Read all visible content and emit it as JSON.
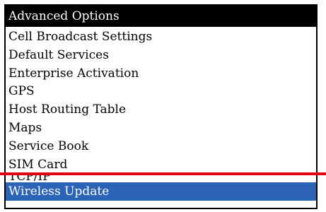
{
  "header": {
    "title": "Advanced Options"
  },
  "menu": {
    "items": [
      {
        "label": "Cell Broadcast Settings"
      },
      {
        "label": "Default Services"
      },
      {
        "label": "Enterprise Activation"
      },
      {
        "label": "GPS"
      },
      {
        "label": "Host Routing Table"
      },
      {
        "label": "Maps"
      },
      {
        "label": "Service Book"
      },
      {
        "label": "SIM Card"
      },
      {
        "label": "TCP/IP"
      },
      {
        "label": "Wireless Update"
      }
    ],
    "selected_index": 9
  },
  "colors": {
    "title_bar_bg": "#000000",
    "selection_bg": "#2b63b7",
    "divider_line": "#e1000f"
  }
}
